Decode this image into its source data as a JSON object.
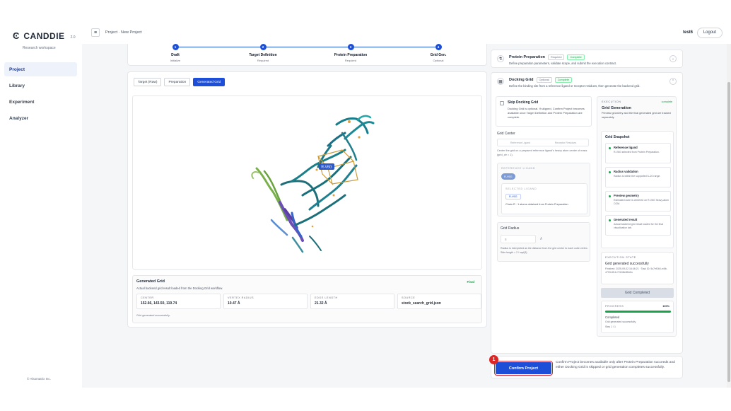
{
  "brand": {
    "name": "CANDDIE",
    "version": "2.0",
    "subtitle": "Research workspace",
    "icon": "c-logo-icon"
  },
  "sidebar": {
    "items": [
      {
        "label": "Project",
        "active": true
      },
      {
        "label": "Library",
        "active": false
      },
      {
        "label": "Experiment",
        "active": false
      },
      {
        "label": "Analyzer",
        "active": false
      }
    ],
    "copyright": "© Alsomatrix Inc."
  },
  "topbar": {
    "menu_icon": "hamburger-icon",
    "breadcrumb": "Project · New Project",
    "user": "test6",
    "logout": "Logout"
  },
  "stepper": {
    "steps": [
      {
        "num": "1",
        "title": "Draft",
        "sub": "Initialize"
      },
      {
        "num": "2",
        "title": "Target Definition",
        "sub": "Required"
      },
      {
        "num": "3",
        "title": "Protein Preparation",
        "sub": "Required"
      },
      {
        "num": "4",
        "title": "Grid Gen.",
        "sub": "Optional"
      }
    ]
  },
  "viewer": {
    "tabs": [
      "Target (Raw)",
      "Preparation",
      "Generated Grid"
    ],
    "active_tab": 2,
    "ligand_label": "R-V6G",
    "grid": {
      "title": "Generated Grid",
      "badge": "Final",
      "desc": "Actual backend grid result loaded from the Docking Grid workflow.",
      "metrics": [
        {
          "label": "CENTER",
          "value": "152.66, 143.50, 119.74"
        },
        {
          "label": "VERTEX RADIUS",
          "value": "10.47 Å"
        },
        {
          "label": "EDGE LENGTH",
          "value": "21.32 Å"
        },
        {
          "label": "SOURCE",
          "value": "stock_search_grid.json"
        }
      ],
      "footer": "Grid generated successfully."
    }
  },
  "protein_prep": {
    "title": "Protein Preparation",
    "tag": "Required",
    "status": "Complete",
    "desc": "Define preparation parameters, validate scope, and submit the execution contract."
  },
  "docking_grid": {
    "title": "Docking Grid",
    "tag": "Optional",
    "status": "Complete",
    "desc": "Define the binding site from a reference ligand or receptor residues, then generate the backend grid.",
    "skip": {
      "title": "Skip Docking Grid",
      "desc": "Docking Grid is optional. If skipped, Confirm Project becomes available once Target Definition and Protein Preparation are complete."
    },
    "grid_center": {
      "label": "Grid Center",
      "options": [
        "Reference Ligand",
        "Receptor Residues"
      ],
      "desc": "Center the grid on a prepared reference ligand's heavy atom centre of mass (grid_ctr = 1)."
    },
    "reference_ligand": {
      "label": "REFERENCE LIGAND",
      "chip": "R-V6G",
      "selected_label": "SELECTED LIGAND",
      "selected_chip": "R-V6G",
      "selected_desc": "Chain R · 1 atoms obtained from Protein Preparation"
    },
    "grid_radius": {
      "title": "Grid Radius",
      "value": "8",
      "unit": "Å",
      "desc": "Radius is interpreted as the distance from the grid center to each cube vertex. Side length = 2 / sqrt(3)."
    },
    "execution": {
      "label": "EXECUTION",
      "state": "complete",
      "title": "Grid Generation",
      "desc": "Preview geometry and the final generated grid are tracked separately."
    },
    "snapshot": {
      "title": "Grid Snapshot",
      "items": [
        {
          "title": "Reference ligand",
          "desc": "R-V6G selected from Protein Preparation."
        },
        {
          "title": "Radius validation",
          "desc": "Radius is within the supported 5–20 range."
        },
        {
          "title": "Preview geometry",
          "desc": "Estimated cube is centered on R-V6G heavy-atom COM."
        },
        {
          "title": "Generated result",
          "desc": "Actual backend grid result loaded for the final visualization tab."
        }
      ]
    },
    "execution_state": {
      "label": "EXECUTION STATE",
      "title": "Grid generated successfully",
      "meta": "Finished: 2025-09-02 16:46:21 · Task ID: 5c7ef2b0-e4fb-4793-8f16-72b38e85bf4c"
    },
    "button": "Grid Completed",
    "progress": {
      "label": "PROGRESS",
      "percent_text": "100%",
      "fraction": 1.0,
      "status": "Completed",
      "desc": "Grid generated successfully.",
      "step": "Step 1 / 1"
    }
  },
  "confirm": {
    "button": "Confirm Project",
    "marker": "1",
    "desc": "Confirm Project becomes available only after Protein Preparation succeeds and either Docking Grid is skipped or grid generation completes successfully."
  },
  "colors": {
    "accent": "#1d4ed8",
    "success": "#16a34a",
    "marker": "#dc2626"
  }
}
